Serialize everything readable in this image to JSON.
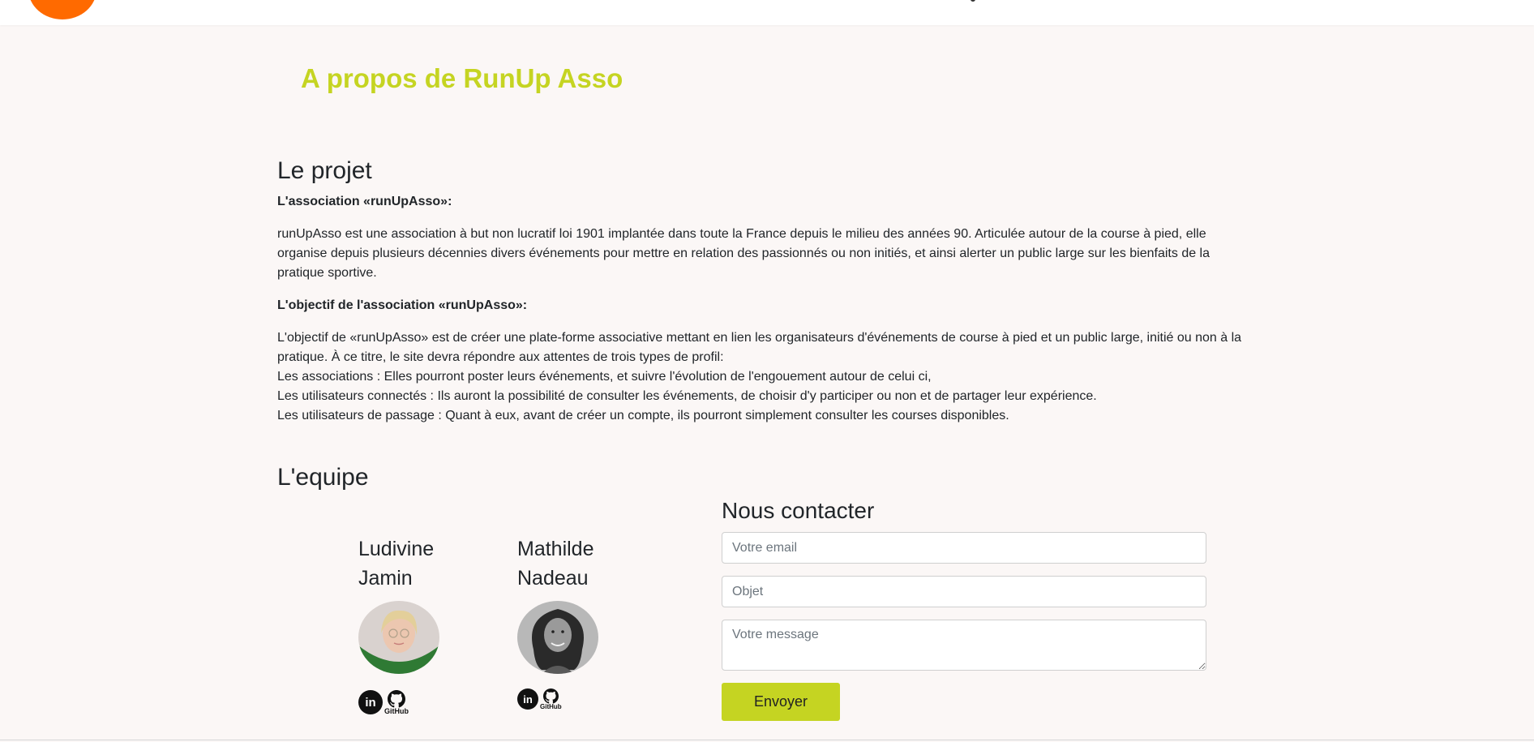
{
  "header": {
    "logo": "runup-logo"
  },
  "page": {
    "title": "A propos de RunUp Asso"
  },
  "projet": {
    "heading": "Le projet",
    "assoc_title": "L'association «runUpAsso»:",
    "assoc_lines": [
      "runUpAsso est une association à but non lucratif loi 1901 implantée dans toute la France depuis le milieu des années 90. Articulée autour de la course à pied, elle",
      "organise depuis plusieurs décennies divers événements pour mettre en relation des passionnés ou non initiés, et ainsi alerter un public large sur les bienfaits de la",
      "pratique sportive."
    ],
    "objectif_title": "L'objectif de l'association «runUpAsso»:",
    "objectif_lines": [
      "L'objectif de «runUpAsso» est de créer une plate-forme associative mettant en lien les organisateurs d'événements de course à pied et un public large, initié ou non à la",
      "pratique. À ce titre, le site devra répondre aux attentes de trois types de profil:",
      "Les associations : Elles pourront poster leurs événements, et suivre l'évolution de l'engouement autour de celui ci,",
      "Les utilisateurs connectés : Ils auront la possibilité de consulter les événements, de choisir d'y participer ou non et de partager leur expérience.",
      "Les utilisateurs de passage : Quant à eux, avant de créer un compte, ils pourront simplement consulter les courses disponibles."
    ]
  },
  "equipe": {
    "heading": "L'equipe",
    "members": [
      {
        "first": "Ludivine",
        "last": "Jamin",
        "linkedin": "in",
        "github": "GitHub"
      },
      {
        "first": "Mathilde",
        "last": "Nadeau",
        "linkedin": "in",
        "github": "GitHub"
      }
    ]
  },
  "contact": {
    "title": "Nous contacter",
    "email_placeholder": "Votre email",
    "objet_placeholder": "Objet",
    "message_placeholder": "Votre message",
    "submit_label": "Envoyer"
  },
  "colors": {
    "accent": "#c5d422",
    "logo": "#ff6a00",
    "background": "#fbf7f6"
  }
}
